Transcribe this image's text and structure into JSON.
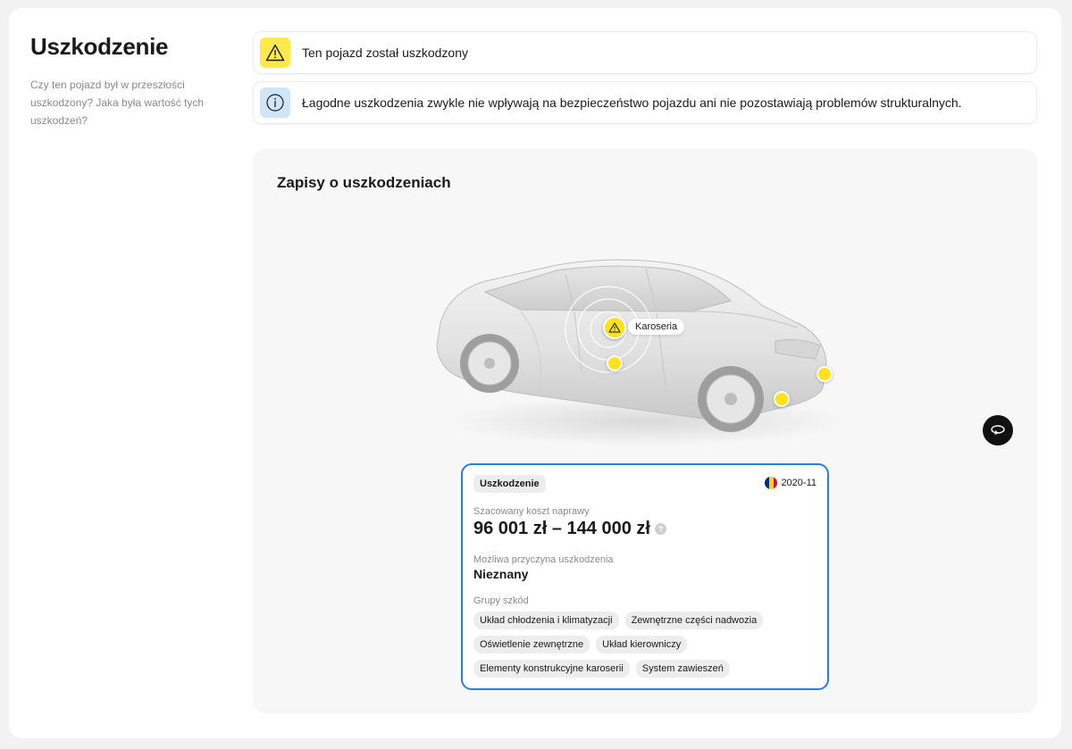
{
  "section": {
    "title": "Uszkodzenie",
    "description": "Czy ten pojazd był w przeszłości uszkodzony? Jaka była wartość tych uszkodzeń?"
  },
  "alerts": [
    {
      "icon": "warning-triangle-icon",
      "text": "Ten pojazd został uszkodzony",
      "color": "#ffe94a"
    },
    {
      "icon": "info-circle-icon",
      "text": "Łagodne uszkodzenia zwykle nie wpływają na bezpieczeństwo pojazdu ani nie pozostawiają problemów strukturalnych.",
      "color": "#cfe6f8"
    }
  ],
  "records": {
    "title": "Zapisy o uszkodzeniach",
    "marker_label": "Karoseria",
    "rotate_icon": "rotate-360-icon",
    "marker_color": "#ffe21a"
  },
  "damage_card": {
    "badge": "Uszkodzenie",
    "date": "2020-11",
    "flag_colors": [
      "#002b7f",
      "#fcd116",
      "#ce1126"
    ],
    "cost_label": "Szacowany koszt naprawy",
    "cost_value": "96 001 zł – 144 000 zł",
    "cause_label": "Możliwa przyczyna uszkodzenia",
    "cause_value": "Nieznany",
    "groups_label": "Grupy szkód",
    "groups": [
      "Układ chłodzenia i klimatyzacji",
      "Zewnętrzne części nadwozia",
      "Oświetlenie zewnętrzne",
      "Układ kierowniczy",
      "Elementy konstrukcyjne karoserii",
      "System zawieszeń"
    ],
    "border_color": "#2b7de0"
  }
}
